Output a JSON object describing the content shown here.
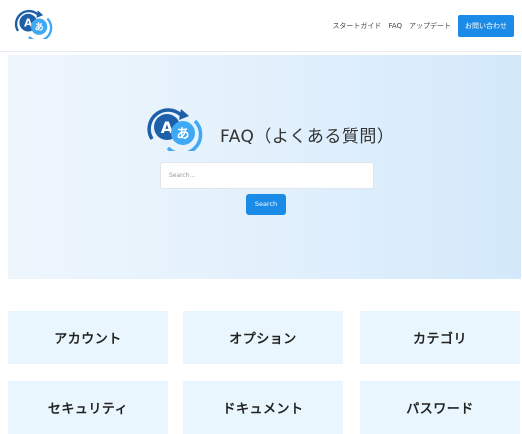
{
  "brand": {
    "logo_letter": "A",
    "logo_kana": "あ"
  },
  "nav": {
    "links": [
      "スタートガイド",
      "FAQ",
      "アップデート"
    ],
    "cta": "お問い合わせ"
  },
  "hero": {
    "title": "FAQ（よくある質問）",
    "search_placeholder": "Search...",
    "search_button": "Search"
  },
  "categories": [
    "アカウント",
    "オプション",
    "カテゴリ",
    "セキュリティ",
    "ドキュメント",
    "パスワード"
  ],
  "colors": {
    "accent": "#1a8be6",
    "logo_dark": "#1d5fa8",
    "logo_light": "#3fa9f5",
    "hero_start": "#eef6fd",
    "hero_end": "#d3e9fb",
    "card_bg": "#eaf6fe"
  }
}
